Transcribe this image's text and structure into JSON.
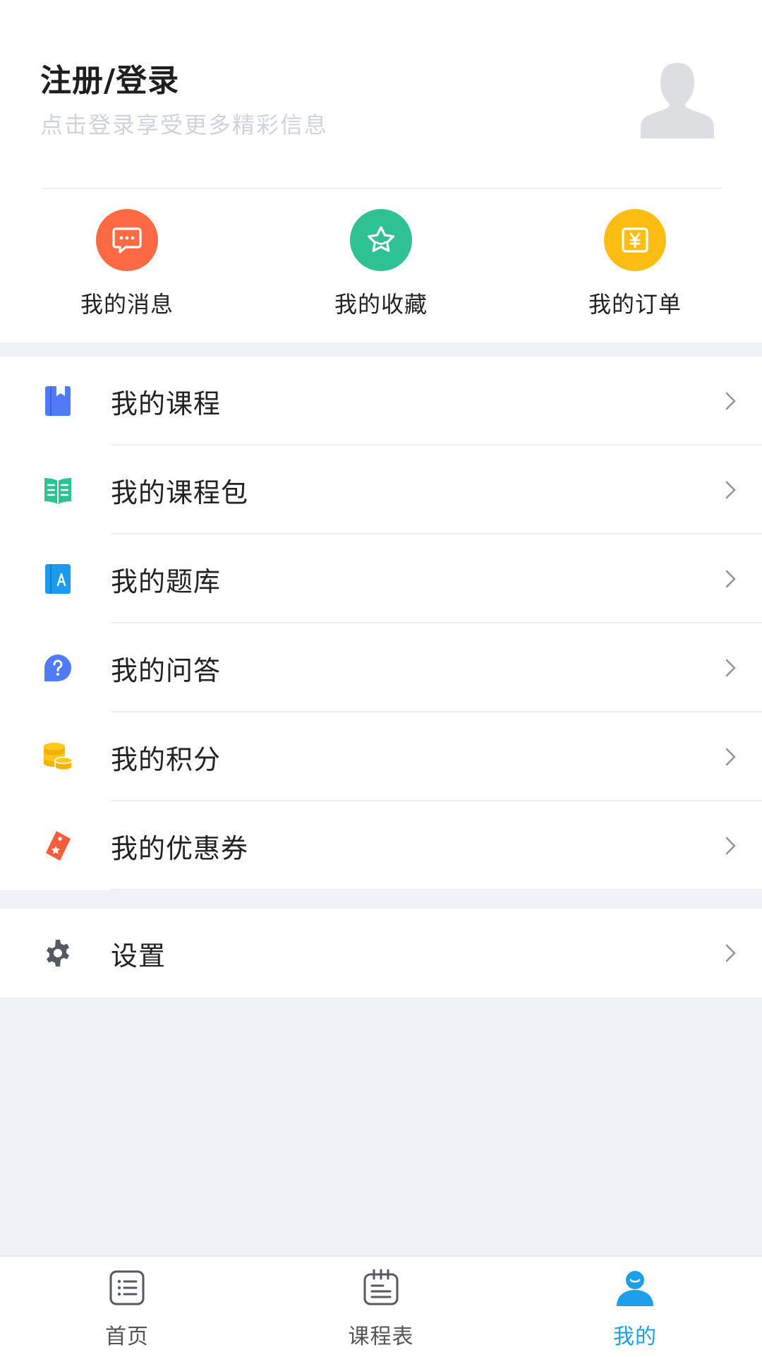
{
  "profile": {
    "title": "注册/登录",
    "subtitle": "点击登录享受更多精彩信息",
    "avatar_icon": "user-avatar-placeholder-icon"
  },
  "quick_actions": [
    {
      "label": "我的消息",
      "icon": "message-icon",
      "color": "#ff6a45"
    },
    {
      "label": "我的收藏",
      "icon": "star-icon",
      "color": "#2ec292"
    },
    {
      "label": "我的订单",
      "icon": "yen-order-icon",
      "color": "#fdbd12"
    }
  ],
  "menu": [
    {
      "label": "我的课程",
      "icon": "course-book-icon",
      "color": "#4f7cf6"
    },
    {
      "label": "我的课程包",
      "icon": "open-book-icon",
      "color": "#2ec292"
    },
    {
      "label": "我的题库",
      "icon": "question-bank-icon",
      "color": "#1a9bf0"
    },
    {
      "label": "我的问答",
      "icon": "question-bubble-icon",
      "color": "#4f7cf6"
    },
    {
      "label": "我的积分",
      "icon": "coins-icon",
      "color": "#fdc81a"
    },
    {
      "label": "我的优惠券",
      "icon": "coupon-tag-icon",
      "color": "#f55d3e"
    }
  ],
  "settings": {
    "label": "设置",
    "icon": "gear-icon",
    "color": "#555a61"
  },
  "tabbar": {
    "active_color": "#1ea0e8",
    "tabs": [
      {
        "label": "首页",
        "icon": "home-list-icon"
      },
      {
        "label": "课程表",
        "icon": "calendar-icon"
      },
      {
        "label": "我的",
        "icon": "user-icon"
      }
    ]
  }
}
